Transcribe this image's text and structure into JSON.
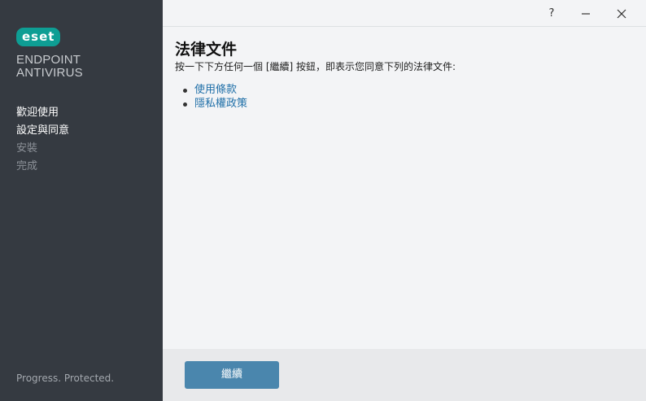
{
  "sidebar": {
    "logo_text": "eset",
    "product_line1": "ENDPOINT",
    "product_line2": "ANTIVIRUS",
    "steps": [
      {
        "label": "歡迎使用",
        "active": true
      },
      {
        "label": "設定與同意",
        "active": true
      },
      {
        "label": "安裝",
        "active": false
      },
      {
        "label": "完成",
        "active": false
      }
    ],
    "tagline": "Progress. Protected."
  },
  "titlebar": {
    "help": "?",
    "minimize": "—",
    "close": "✕"
  },
  "main": {
    "title": "法律文件",
    "subtitle": "按一下下方任何一個 [繼續] 按鈕，即表示您同意下列的法律文件:",
    "links": [
      {
        "label": "使用條款"
      },
      {
        "label": "隱私權政策"
      }
    ]
  },
  "footer": {
    "continue_label": "繼續"
  },
  "colors": {
    "sidebar_bg": "#353a41",
    "brand": "#0e9e94",
    "link": "#1f6fa8",
    "button": "#4a86ad"
  }
}
